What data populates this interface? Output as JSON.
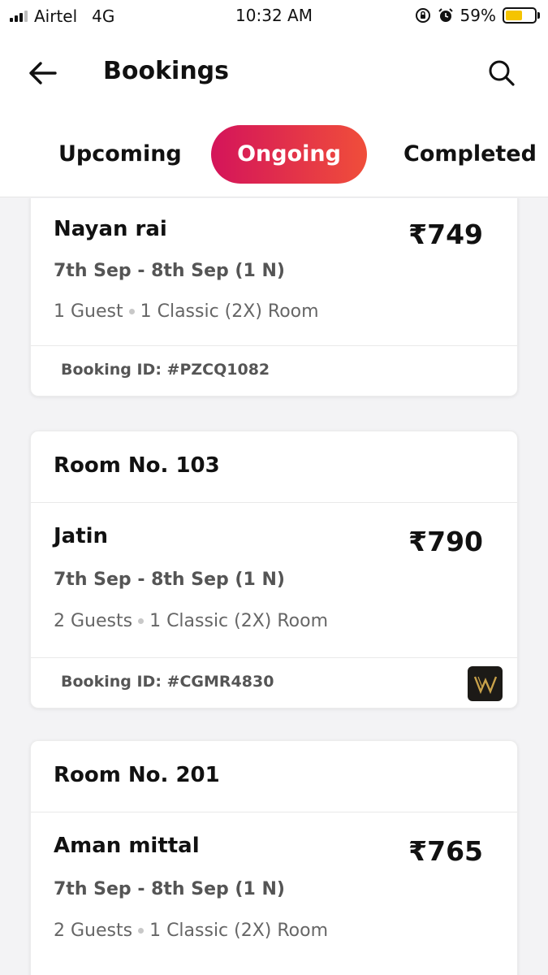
{
  "status_bar": {
    "carrier": "Airtel",
    "network": "4G",
    "time": "10:32 AM",
    "battery_percent": "59%",
    "battery_level": 0.59,
    "battery_color": "#f5c400",
    "icons": [
      "orientation-lock-icon",
      "alarm-icon"
    ]
  },
  "header": {
    "title": "Bookings",
    "back_icon": "arrow-left-icon",
    "search_icon": "search-icon"
  },
  "tabs": [
    {
      "label": "Upcoming",
      "active": false
    },
    {
      "label": "Ongoing",
      "active": true
    },
    {
      "label": "Completed",
      "active": false
    }
  ],
  "accent_gradient": [
    "#d4145a",
    "#f04e3a"
  ],
  "bookings": [
    {
      "room": "",
      "guest": "Nayan rai",
      "price": "₹749",
      "dates": "7th Sep - 8th Sep (1 N)",
      "guests": "1 Guest",
      "room_type": "1 Classic (2X) Room",
      "booking_id": "Booking ID: #PZCQ1082"
    },
    {
      "room": "Room No. 103",
      "guest": "Jatin",
      "price": "₹790",
      "dates": "7th Sep - 8th Sep (1 N)",
      "guests": "2 Guests",
      "room_type": "1 Classic (2X) Room",
      "booking_id": "Booking ID: #CGMR4830",
      "brand_icon": "w-logo-icon"
    },
    {
      "room": "Room No. 201",
      "guest": "Aman mittal",
      "price": "₹765",
      "dates": "7th Sep - 8th Sep (1 N)",
      "guests": "2 Guests",
      "room_type": "1 Classic (2X) Room"
    }
  ]
}
